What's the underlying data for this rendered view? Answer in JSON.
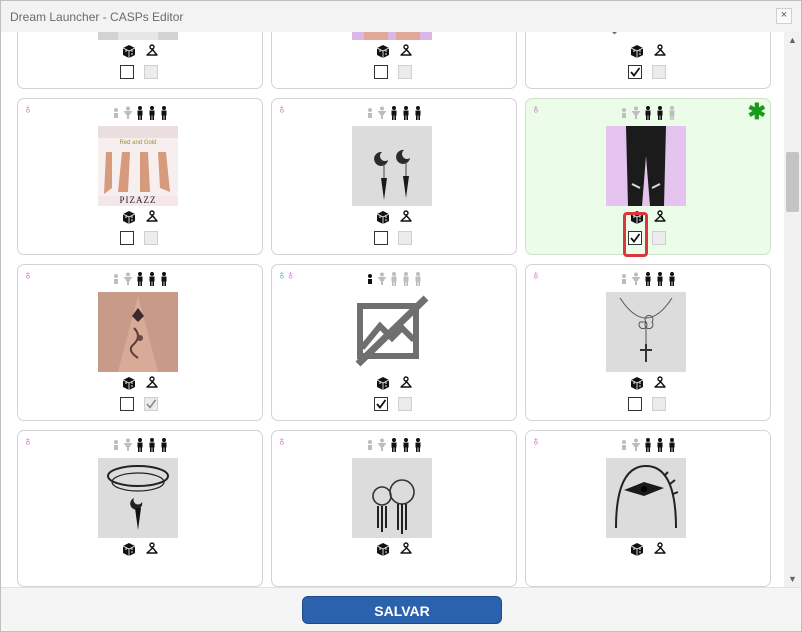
{
  "window": {
    "title": "Dream Launcher - CASPs Editor",
    "close_glyph": "×"
  },
  "footer": {
    "save_label": "SALVAR"
  },
  "colors": {
    "accent": "#2b62ad",
    "female": "#e24ed5",
    "male": "#1bb3e0",
    "selected_bg": "#ebfce9",
    "new_badge": "#1a9c1a",
    "highlight": "#d9363e"
  },
  "new_badge": "✱",
  "cards": [
    {
      "thumb": "face-icon",
      "ages": [
        1,
        1,
        1,
        1,
        1
      ],
      "check1": false,
      "check2": false
    },
    {
      "thumb": "fishnet-legs-icon",
      "ages": [
        1,
        1,
        1,
        1,
        1
      ],
      "check1": false,
      "check2": false
    },
    {
      "thumb": "no-image-icon",
      "ages": [
        1,
        1,
        1,
        1,
        1
      ],
      "check1": true,
      "check2": false
    },
    {
      "gender": "♁",
      "thumb": "pizazz-feet-icon",
      "ages": [
        0,
        0,
        1,
        1,
        1
      ],
      "check1": false,
      "check2": false,
      "thumb_text": [
        "Red and Gold",
        "PIZAZZ"
      ]
    },
    {
      "gender": "♁",
      "thumb": "moon-earrings-icon",
      "ages": [
        0,
        0,
        1,
        1,
        1
      ],
      "check1": false,
      "check2": false
    },
    {
      "gender": "♁",
      "thumb": "black-pants-icon",
      "ages": [
        0,
        0,
        1,
        1,
        0
      ],
      "check1": true,
      "check2": false,
      "selected": true
    },
    {
      "gender": "♁",
      "thumb": "back-tattoo-icon",
      "ages": [
        0,
        0,
        1,
        1,
        1
      ],
      "check1": false,
      "check2": true
    },
    {
      "gender": "♁♁",
      "thumb": "no-image-icon",
      "ages": [
        1,
        0,
        0,
        0,
        0
      ],
      "check1": true,
      "check2": false
    },
    {
      "gender": "♁",
      "thumb": "cross-necklace-icon",
      "ages": [
        0,
        0,
        1,
        1,
        1
      ],
      "check1": false,
      "check2": false
    },
    {
      "gender": "♁",
      "thumb": "moon-choker-icon",
      "ages": [
        0,
        0,
        1,
        1,
        1
      ]
    },
    {
      "gender": "♁",
      "thumb": "hoop-earrings-icon",
      "ages": [
        0,
        0,
        1,
        1,
        1
      ]
    },
    {
      "gender": "♁",
      "thumb": "bow-headband-icon",
      "ages": [
        0,
        0,
        1,
        1,
        1
      ]
    }
  ]
}
